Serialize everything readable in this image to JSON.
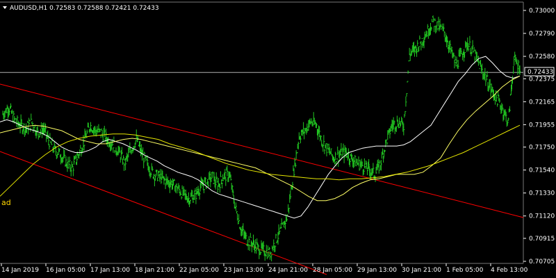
{
  "header": {
    "symbol_line": "AUDUSD,H1  0.72583 0.72588 0.72421 0.72433",
    "menu_icon": "triangle-down-icon"
  },
  "side_label": "ad",
  "colors": {
    "background": "#000000",
    "candles": "#22c722",
    "channel": "#ff0000",
    "ma_fast": "#ffffff",
    "ma_slow": "#ffff66",
    "ma_long": "#e6e600",
    "price_line": "#b0b0b0",
    "text": "#ffffff"
  },
  "chart_data": {
    "type": "line",
    "symbol": "AUDUSD",
    "timeframe": "H1",
    "current_price": 0.72433,
    "current_price_label": "0.72433",
    "ylim": [
      0.70705,
      0.73
    ],
    "y_ticks": [
      "0.73000",
      "0.72790",
      "0.72580",
      "0.72375",
      "0.72165",
      "0.71955",
      "0.71750",
      "0.71540",
      "0.71330",
      "0.71120",
      "0.70915",
      "0.70705"
    ],
    "x_ticks": [
      "14 Jan 2019",
      "16 Jan 05:00",
      "17 Jan 13:00",
      "18 Jan 21:00",
      "22 Jan 05:00",
      "23 Jan 13:00",
      "24 Jan 21:00",
      "28 Jan 05:00",
      "29 Jan 13:00",
      "30 Jan 21:00",
      "1 Feb 05:00",
      "4 Feb 13:00"
    ],
    "price_series": [
      0.7205,
      0.7212,
      0.72,
      0.7195,
      0.7192,
      0.7198,
      0.7188,
      0.7192,
      0.718,
      0.7172,
      0.7168,
      0.716,
      0.7156,
      0.7168,
      0.718,
      0.7195,
      0.719,
      0.7188,
      0.7182,
      0.7178,
      0.717,
      0.716,
      0.7172,
      0.7182,
      0.7168,
      0.7158,
      0.715,
      0.7148,
      0.7144,
      0.7142,
      0.7138,
      0.7132,
      0.7128,
      0.713,
      0.7138,
      0.7142,
      0.7148,
      0.714,
      0.7148,
      0.715,
      0.712,
      0.71,
      0.709,
      0.7087,
      0.7082,
      0.708,
      0.7078,
      0.709,
      0.71,
      0.7112,
      0.715,
      0.7185,
      0.719,
      0.7198,
      0.7195,
      0.718,
      0.7172,
      0.7165,
      0.7168,
      0.717,
      0.7165,
      0.716,
      0.7158,
      0.7155,
      0.715,
      0.716,
      0.718,
      0.7195,
      0.7198,
      0.7195,
      0.726,
      0.7265,
      0.7272,
      0.728,
      0.729,
      0.7285,
      0.728,
      0.7265,
      0.725,
      0.726,
      0.727,
      0.7262,
      0.725,
      0.724,
      0.7228,
      0.722,
      0.721,
      0.7198,
      0.7255,
      0.7248
    ],
    "ma_fast": [
      0.7198,
      0.72,
      0.7198,
      0.7195,
      0.7192,
      0.719,
      0.7188,
      0.7185,
      0.718,
      0.7175,
      0.7172,
      0.717,
      0.717,
      0.7172,
      0.7175,
      0.718,
      0.7182,
      0.718,
      0.7178,
      0.7175,
      0.7172,
      0.7168,
      0.7165,
      0.7162,
      0.7158,
      0.7155,
      0.7152,
      0.715,
      0.7148,
      0.7145,
      0.714,
      0.7135,
      0.7132,
      0.713,
      0.7128,
      0.7126,
      0.7124,
      0.7122,
      0.712,
      0.7118,
      0.7116,
      0.7114,
      0.7112,
      0.711,
      0.7112,
      0.712,
      0.713,
      0.714,
      0.715,
      0.7158,
      0.7165,
      0.717,
      0.7172,
      0.7174,
      0.7175,
      0.7176,
      0.7176,
      0.7176,
      0.7176,
      0.7177,
      0.718,
      0.7185,
      0.719,
      0.7195,
      0.7205,
      0.7215,
      0.7225,
      0.7235,
      0.7242,
      0.725,
      0.7256,
      0.7258,
      0.7252,
      0.7245,
      0.724,
      0.7238,
      0.724
    ],
    "ma_slow": [
      0.7188,
      0.719,
      0.7192,
      0.7194,
      0.7195,
      0.7194,
      0.7192,
      0.719,
      0.7186,
      0.7182,
      0.718,
      0.7178,
      0.7178,
      0.718,
      0.7182,
      0.7183,
      0.7182,
      0.718,
      0.7178,
      0.7176,
      0.7174,
      0.7172,
      0.717,
      0.7168,
      0.7166,
      0.7164,
      0.7162,
      0.716,
      0.7158,
      0.7156,
      0.7152,
      0.7148,
      0.7144,
      0.714,
      0.7135,
      0.713,
      0.7126,
      0.7126,
      0.7128,
      0.7132,
      0.7138,
      0.7142,
      0.7145,
      0.7146,
      0.7148,
      0.715,
      0.715,
      0.715,
      0.7152,
      0.7158,
      0.7165,
      0.7178,
      0.719,
      0.72,
      0.7208,
      0.7215,
      0.7222,
      0.723,
      0.7236,
      0.724
    ],
    "ma_long": [
      0.713,
      0.714,
      0.715,
      0.716,
      0.7168,
      0.7175,
      0.718,
      0.7183,
      0.7185,
      0.7186,
      0.7187,
      0.7187,
      0.7186,
      0.7184,
      0.7182,
      0.7178,
      0.7175,
      0.7172,
      0.7168,
      0.7164,
      0.716,
      0.7157,
      0.7154,
      0.7152,
      0.715,
      0.7149,
      0.7148,
      0.7147,
      0.7146,
      0.7146,
      0.7145,
      0.7146,
      0.7146,
      0.7147,
      0.7148,
      0.715,
      0.7152,
      0.7155,
      0.7158,
      0.7162,
      0.7166,
      0.717,
      0.7175,
      0.718,
      0.7185,
      0.719,
      0.7195
    ]
  }
}
